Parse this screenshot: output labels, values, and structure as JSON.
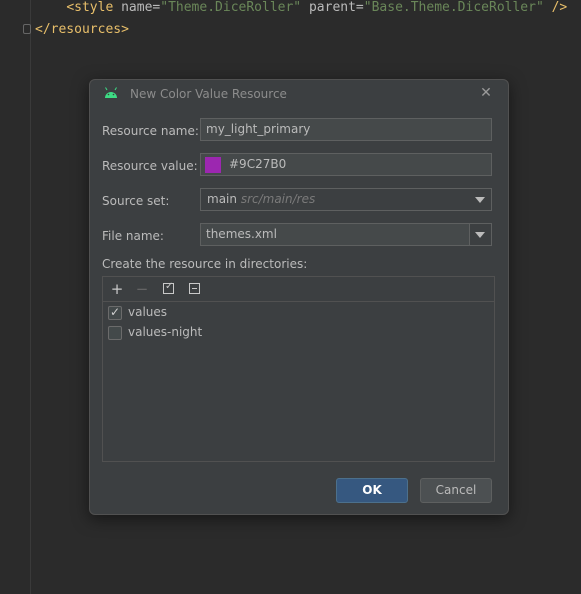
{
  "editor": {
    "line1": {
      "open_tag": "<style",
      "attr1": " name=",
      "val1": "\"Theme.DiceRoller\"",
      "attr2": " parent=",
      "val2": "\"Base.Theme.DiceRoller\"",
      "close": " />"
    },
    "line2": "</resources>"
  },
  "dialog": {
    "title": "New Color Value Resource",
    "close_glyph": "✕",
    "resource_name_label": "Resource name:",
    "resource_name_value": "my_light_primary",
    "resource_value_label": "Resource value:",
    "resource_value_value": "#9C27B0",
    "resource_value_color": "#9C27B0",
    "source_set_label": "Source set:",
    "source_set_value": "main",
    "source_set_hint": "src/main/res",
    "file_name_label": "File name:",
    "file_name_value": "themes.xml",
    "directories_label": "Create the resource in directories:",
    "toolbar": {
      "add": "+",
      "remove": "−"
    },
    "directories": [
      {
        "label": "values",
        "checked": true
      },
      {
        "label": "values-night",
        "checked": false
      }
    ],
    "ok_label": "OK",
    "cancel_label": "Cancel"
  }
}
